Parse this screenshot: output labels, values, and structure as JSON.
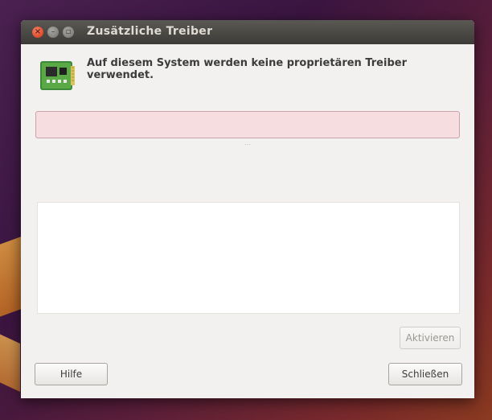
{
  "window": {
    "title": "Zusätzliche Treiber"
  },
  "window_controls": {
    "close_glyph": "×",
    "minimize_glyph": "–",
    "maximize_glyph": "▫"
  },
  "header": {
    "message": "Auf diesem System werden keine proprietären Treiber verwendet.",
    "icon": "driver-card-icon"
  },
  "pane": {
    "handle_glyph": "⋯"
  },
  "buttons": {
    "activate_label": "Aktivieren",
    "help_label": "Hilfe",
    "close_label": "Schließen"
  },
  "colors": {
    "titlebar": "#3c3b37",
    "window_bg": "#f2f1f0",
    "info_bar_bg": "#f5dde0",
    "close_button": "#df4a2a"
  }
}
